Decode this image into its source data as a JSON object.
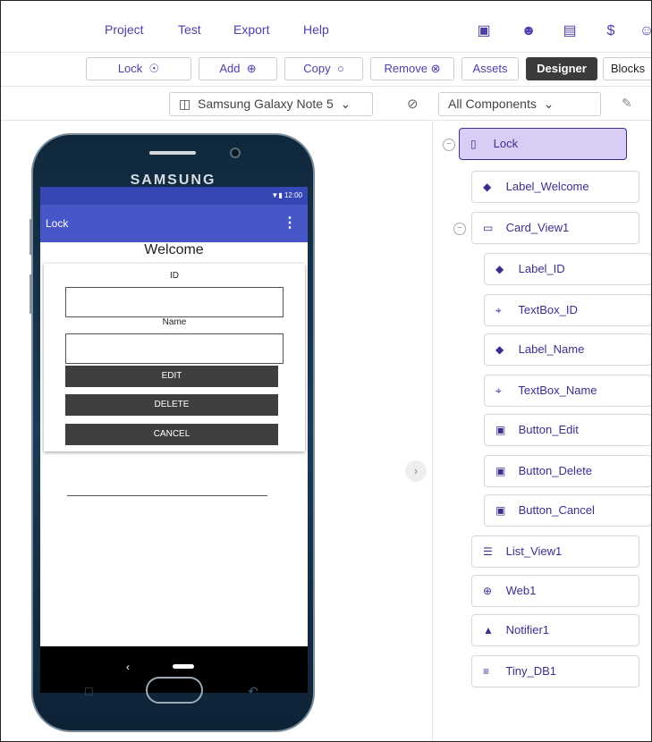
{
  "menubar": {
    "items": [
      "Project",
      "Test",
      "Export",
      "Help"
    ],
    "icons": [
      "folder-star-icon",
      "palette-icon",
      "document-icon",
      "dollar-icon",
      "user-icon"
    ]
  },
  "toolbar": {
    "lock": "Lock",
    "add": "Add",
    "copy": "Copy",
    "remove": "Remove",
    "assets": "Assets",
    "designer": "Designer",
    "blocks": "Blocks"
  },
  "device": {
    "selected": "Samsung Galaxy Note 5",
    "filter": "All Components"
  },
  "phone": {
    "brand": "SAMSUNG",
    "time": "12:00",
    "app_title": "Lock",
    "welcome": "Welcome",
    "label_id": "ID",
    "label_name": "Name",
    "btn_edit": "EDIT",
    "btn_delete": "DELETE",
    "btn_cancel": "CANCEL"
  },
  "tree": [
    {
      "label": "Lock",
      "icon": "phone-icon",
      "glyph": "▯",
      "selected": true
    },
    {
      "label": "Label_Welcome",
      "icon": "label-icon",
      "glyph": "◆"
    },
    {
      "label": "Card_View1",
      "icon": "card-icon",
      "glyph": "▭"
    },
    {
      "label": "Label_ID",
      "icon": "label-icon",
      "glyph": "◆"
    },
    {
      "label": "TextBox_ID",
      "icon": "textbox-icon",
      "glyph": "⌶"
    },
    {
      "label": "Label_Name",
      "icon": "label-icon",
      "glyph": "◆"
    },
    {
      "label": "TextBox_Name",
      "icon": "textbox-icon",
      "glyph": "⌶"
    },
    {
      "label": "Button_Edit",
      "icon": "button-icon",
      "glyph": "▣"
    },
    {
      "label": "Button_Delete",
      "icon": "button-icon",
      "glyph": "▣"
    },
    {
      "label": "Button_Cancel",
      "icon": "button-icon",
      "glyph": "▣"
    },
    {
      "label": "List_View1",
      "icon": "list-icon",
      "glyph": "☰"
    },
    {
      "label": "Web1",
      "icon": "globe-icon",
      "glyph": "⊕"
    },
    {
      "label": "Notifier1",
      "icon": "bell-icon",
      "glyph": "▲"
    },
    {
      "label": "Tiny_DB1",
      "icon": "database-icon",
      "glyph": "≡"
    }
  ]
}
